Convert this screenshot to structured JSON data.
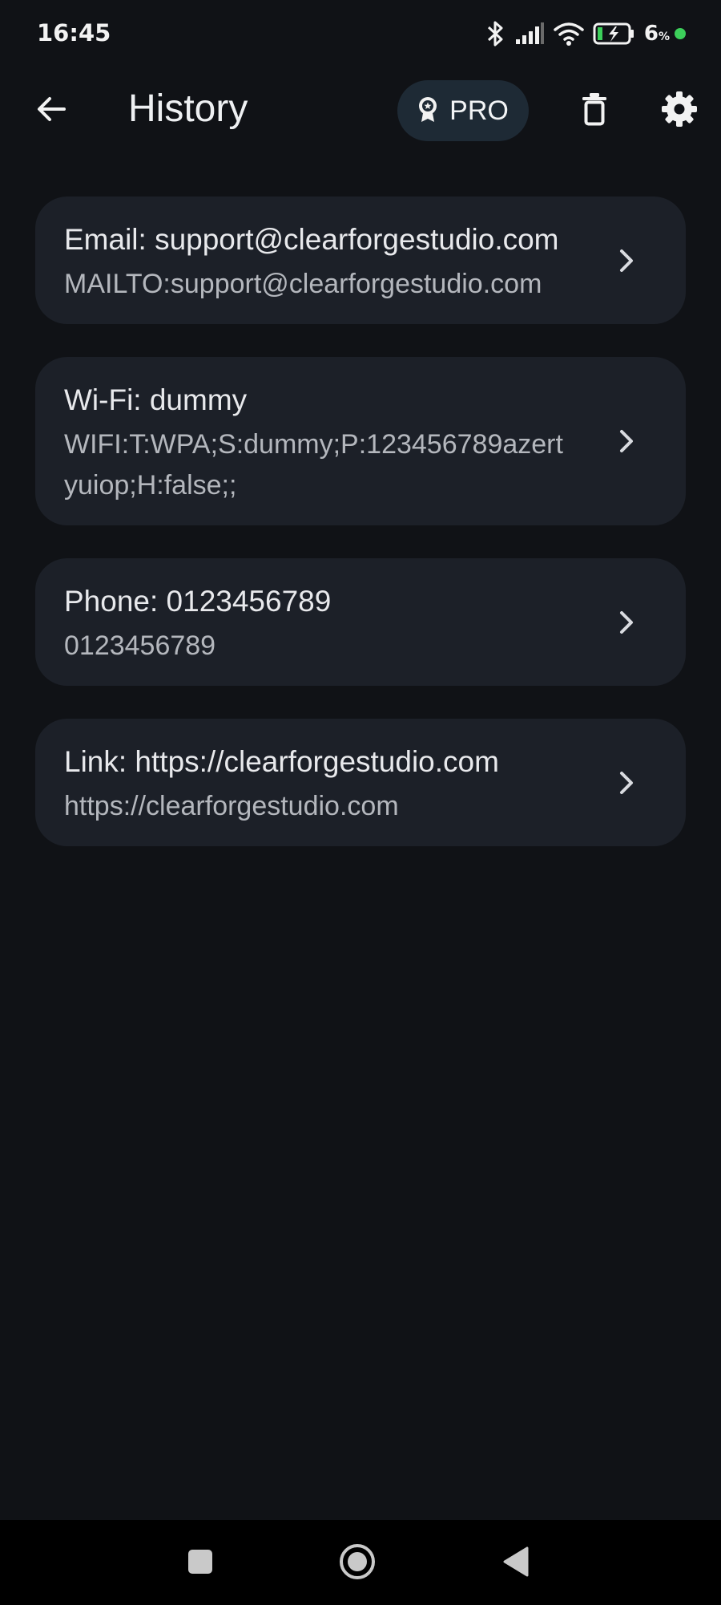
{
  "status_bar": {
    "time": "16:45",
    "battery_percent": "6",
    "battery_unit": "%",
    "icons": [
      "bluetooth-icon",
      "signal-icon",
      "wifi-icon",
      "battery-charging-icon"
    ],
    "charging_dot_color": "#3ccf5a"
  },
  "header": {
    "title": "History",
    "pro_label": "PRO",
    "icons": [
      "back-arrow-icon",
      "award-badge-icon",
      "trash-icon",
      "gear-icon"
    ]
  },
  "history_items": [
    {
      "title": "Email: support@clearforgestudio.com",
      "subtitle": "MAILTO:support@clearforgestudio.com"
    },
    {
      "title": "Wi-Fi: dummy",
      "subtitle": "WIFI:T:WPA;S:dummy;P:123456789azertyuiop;H:false;;"
    },
    {
      "title": "Phone: 0123456789",
      "subtitle": "0123456789"
    },
    {
      "title": "Link: https://clearforgestudio.com",
      "subtitle": "https://clearforgestudio.com"
    }
  ],
  "nav_bar": {
    "icons": [
      "recents-square-icon",
      "home-circle-icon",
      "back-triangle-icon"
    ]
  },
  "colors": {
    "background": "#101216",
    "card": "#1c2028",
    "pro_button": "#1e2a35",
    "nav_bar": "#000000"
  }
}
